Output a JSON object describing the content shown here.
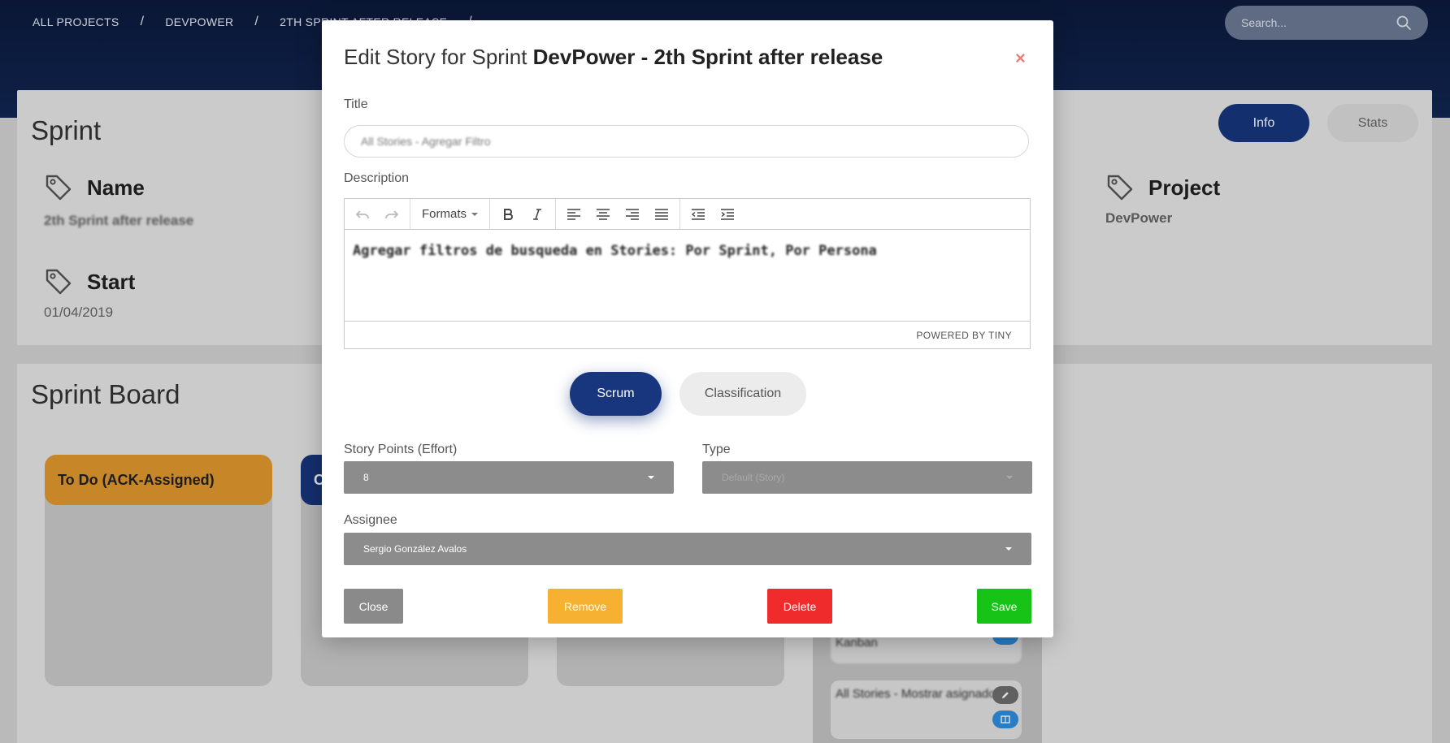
{
  "breadcrumb": {
    "items": [
      "ALL PROJECTS",
      "DEVPOWER",
      "2TH SPRINT AFTER RELEASE"
    ],
    "separator": "/"
  },
  "search": {
    "placeholder": "Search...",
    "icon": "search-icon"
  },
  "sprint": {
    "heading": "Sprint",
    "tabs": {
      "info": "Info",
      "stats": "Stats"
    },
    "name": {
      "label": "Name",
      "value": "2th Sprint after release",
      "icon": "tag-icon"
    },
    "start": {
      "label": "Start",
      "value": "01/04/2019",
      "icon": "tag-icon"
    },
    "project": {
      "label": "Project",
      "value": "DevPower",
      "icon": "tag-icon"
    }
  },
  "board": {
    "heading": "Sprint Board",
    "columns": [
      {
        "title": "To Do (ACK-Assigned)",
        "color": "#e39a2f"
      },
      {
        "title": "C",
        "color": "#17367e"
      },
      {
        "title": "",
        "color": "#cbcbcb"
      }
    ],
    "stories": [
      {
        "title": "Kanban"
      },
      {
        "title": "All Stories - Mostrar asignado"
      }
    ]
  },
  "modal": {
    "title_prefix": "Edit Story for Sprint",
    "title_bold": "DevPower - 2th Sprint after release",
    "close_symbol": "×",
    "title_label": "Title",
    "title_value": "All Stories - Agregar Filtro",
    "description_label": "Description",
    "editor": {
      "formats_label": "Formats",
      "content": "Agregar filtros de busqueda en Stories: Por Sprint, Por Persona",
      "powered_by": "POWERED BY TINY"
    },
    "tabs": {
      "scrum": "Scrum",
      "classification": "Classification"
    },
    "story_points_label": "Story Points (Effort)",
    "story_points_value": "8",
    "type_label": "Type",
    "type_value": "Default (Story)",
    "assignee_label": "Assignee",
    "assignee_value": "Sergio González Avalos",
    "buttons": {
      "close": "Close",
      "remove": "Remove",
      "delete": "Delete",
      "save": "Save"
    }
  },
  "colors": {
    "primary": "#17367e",
    "warning": "#f6b132",
    "danger": "#ef2b2b",
    "success": "#17c317",
    "neutral": "#8a8a8a"
  }
}
